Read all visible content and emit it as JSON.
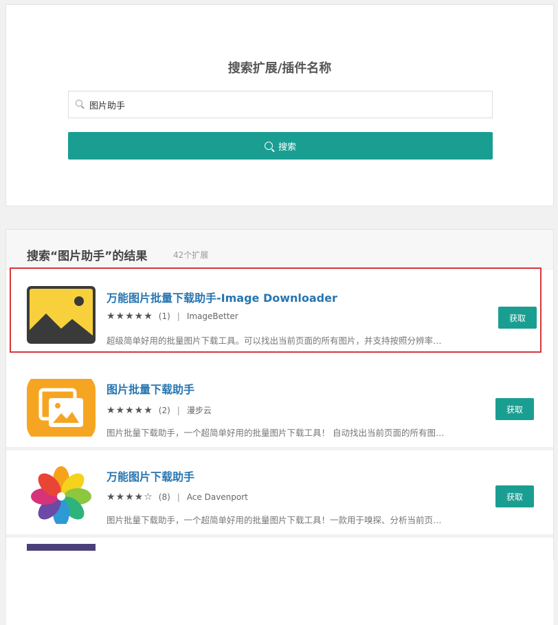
{
  "search": {
    "title": "搜索扩展/插件名称",
    "value": "图片助手",
    "button_label": "搜索"
  },
  "results": {
    "title": "搜索“图片助手”的结果",
    "count": "42个扩展",
    "items": [
      {
        "name": "万能图片批量下载助手-Image Downloader",
        "stars": "★★★★★",
        "rating_count": "(1)",
        "separator": "|",
        "author": "ImageBetter",
        "description": "超级简单好用的批量图片下载工具。可以找出当前页面的所有图片，并支持按照分辨率…",
        "button": "获取",
        "icon": "landscape-image-icon",
        "highlighted": true
      },
      {
        "name": "图片批量下载助手",
        "stars": "★★★★★",
        "rating_count": "(2)",
        "separator": "|",
        "author": "漫步云",
        "description": "图片批量下载助手，一个超简单好用的批量图片下载工具！ 自动找出当前页面的所有图…",
        "button": "获取",
        "icon": "photo-gallery-icon"
      },
      {
        "name": "万能图片下载助手",
        "stars": "★★★★☆",
        "rating_count": "(8)",
        "separator": "|",
        "author": "Ace Davenport",
        "description": "图片批量下载助手，一个超简单好用的批量图片下载工具！一款用于嗅探、分析当前页…",
        "button": "获取",
        "icon": "flower-petals-icon"
      }
    ]
  },
  "colors": {
    "accent": "#1a9e92",
    "link": "#2775b0",
    "highlight_border": "#d6363a"
  }
}
